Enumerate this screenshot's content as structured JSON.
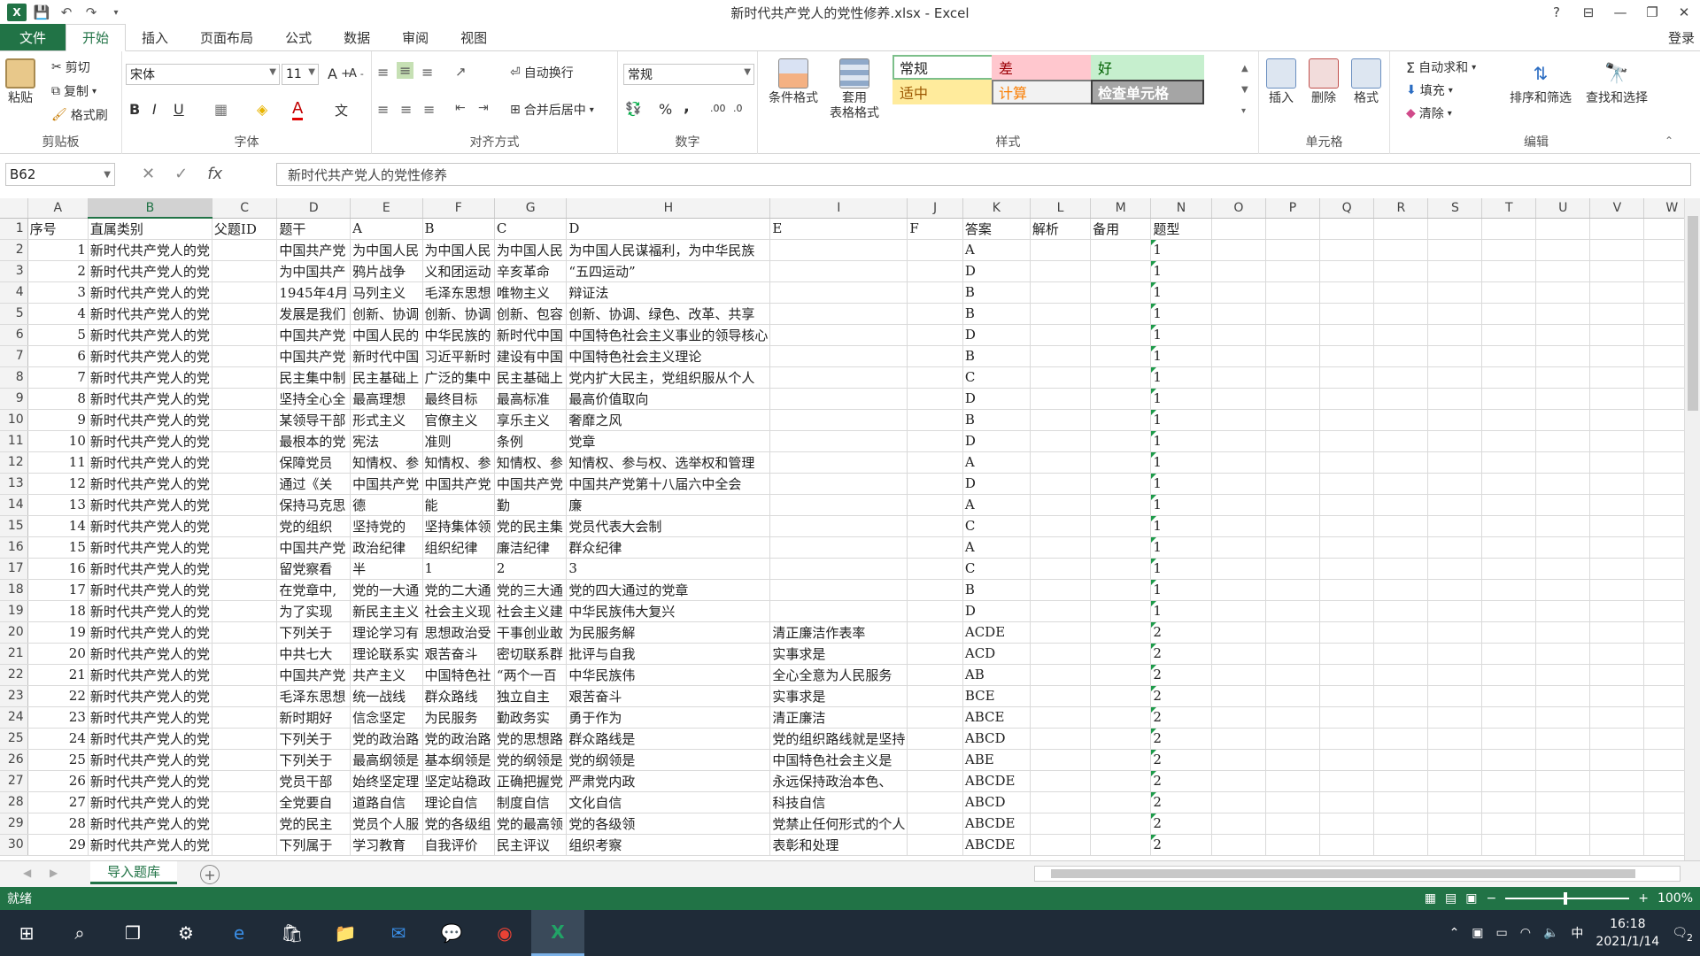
{
  "window": {
    "title": "新时代共产党人的党性修养.xlsx - Excel",
    "help": "?",
    "controls": [
      "⊟",
      "—",
      "❐",
      "✕"
    ]
  },
  "ribbon_tabs": [
    "文件",
    "开始",
    "插入",
    "页面布局",
    "公式",
    "数据",
    "审阅",
    "视图"
  ],
  "login_label": "登录",
  "clipboard": {
    "paste": "粘贴",
    "cut": "剪切",
    "copy": "复制",
    "format_painter": "格式刷",
    "label": "剪贴板"
  },
  "font": {
    "name": "宋体",
    "size": "11",
    "label": "字体",
    "bold": "B",
    "italic": "I",
    "underline": "U"
  },
  "alignment": {
    "wrap": "自动换行",
    "merge": "合并后居中",
    "label": "对齐方式"
  },
  "number": {
    "format": "常规",
    "label": "数字",
    "percent": "%",
    "comma": ","
  },
  "styles": {
    "conditional": "条件格式",
    "table": "套用\n表格格式",
    "label": "样式",
    "cells": [
      {
        "text": "常规",
        "bg": "#ffffff",
        "color": "#222222",
        "border": "#7cbf8a"
      },
      {
        "text": "差",
        "bg": "#ffc7ce",
        "color": "#9c0006",
        "border": "#ffc7ce"
      },
      {
        "text": "好",
        "bg": "#c6efce",
        "color": "#006100",
        "border": "#c6efce"
      },
      {
        "text": "适中",
        "bg": "#ffeb9c",
        "color": "#9c5700",
        "border": "#ffeb9c"
      },
      {
        "text": "计算",
        "bg": "#f2f2f2",
        "color": "#fa7d00",
        "border": "#7f7f7f"
      },
      {
        "text": "检查单元格",
        "bg": "#a5a5a5",
        "color": "#ffffff",
        "border": "#3f3f3f"
      }
    ]
  },
  "cells_group": {
    "insert": "插入",
    "delete": "删除",
    "format": "格式",
    "label": "单元格"
  },
  "editing": {
    "autosum": "自动求和",
    "fill": "填充",
    "clear": "清除",
    "sort": "排序和筛选",
    "find": "查找和选择",
    "label": "编辑"
  },
  "formula_bar": {
    "name_box": "B62",
    "fx": "fx",
    "value": "新时代共产党人的党性修养"
  },
  "columns": [
    "A",
    "B",
    "C",
    "D",
    "E",
    "F",
    "G",
    "H",
    "I",
    "J",
    "K",
    "L",
    "M",
    "N",
    "O",
    "P",
    "Q",
    "R",
    "S",
    "T",
    "U",
    "V",
    "W"
  ],
  "selected_column": "B",
  "header_row": [
    "序号",
    "直属类别",
    "父题ID",
    "题干",
    "A",
    "B",
    "C",
    "D",
    "E",
    "F",
    "答案",
    "解析",
    "备用",
    "题型"
  ],
  "rows": [
    [
      "1",
      "新时代共产党人的党",
      "",
      "中国共产党",
      "为中国人民",
      "为中国人民",
      "为中国人民",
      "为中国人民谋福利，为中华民族",
      "",
      "",
      "A",
      "",
      "",
      "1"
    ],
    [
      "2",
      "新时代共产党人的党",
      "",
      "为中国共产",
      "鸦片战争",
      "义和团运动",
      "辛亥革命",
      "“五四运动”",
      "",
      "",
      "D",
      "",
      "",
      "1"
    ],
    [
      "3",
      "新时代共产党人的党",
      "",
      "1945年4月",
      "马列主义",
      "毛泽东思想",
      "唯物主义",
      "辩证法",
      "",
      "",
      "B",
      "",
      "",
      "1"
    ],
    [
      "4",
      "新时代共产党人的党",
      "",
      "发展是我们",
      "创新、协调",
      "创新、协调",
      "创新、包容",
      "创新、协调、绿色、改革、共享",
      "",
      "",
      "B",
      "",
      "",
      "1"
    ],
    [
      "5",
      "新时代共产党人的党",
      "",
      "中国共产党",
      "中国人民的",
      "中华民族的",
      "新时代中国",
      "中国特色社会主义事业的领导核心",
      "",
      "",
      "D",
      "",
      "",
      "1"
    ],
    [
      "6",
      "新时代共产党人的党",
      "",
      "中国共产党",
      "新时代中国",
      "习近平新时",
      "建设有中国",
      "中国特色社会主义理论",
      "",
      "",
      "B",
      "",
      "",
      "1"
    ],
    [
      "7",
      "新时代共产党人的党",
      "",
      "民主集中制",
      "民主基础上",
      "广泛的集中",
      "民主基础上",
      "党内扩大民主，党组织服从个人",
      "",
      "",
      "C",
      "",
      "",
      "1"
    ],
    [
      "8",
      "新时代共产党人的党",
      "",
      "坚持全心全",
      "最高理想",
      "最终目标",
      "最高标准",
      "最高价值取向",
      "",
      "",
      "D",
      "",
      "",
      "1"
    ],
    [
      "9",
      "新时代共产党人的党",
      "",
      "某领导干部",
      "形式主义",
      "官僚主义",
      "享乐主义",
      "奢靡之风",
      "",
      "",
      "B",
      "",
      "",
      "1"
    ],
    [
      "10",
      "新时代共产党人的党",
      "",
      "最根本的党",
      "宪法",
      "准则",
      "条例",
      "党章",
      "",
      "",
      "D",
      "",
      "",
      "1"
    ],
    [
      "11",
      "新时代共产党人的党",
      "",
      "保障党员",
      "知情权、参",
      "知情权、参",
      "知情权、参",
      "知情权、参与权、选举权和管理",
      "",
      "",
      "A",
      "",
      "",
      "1"
    ],
    [
      "12",
      "新时代共产党人的党",
      "",
      "通过《关",
      "中国共产党",
      "中国共产党",
      "中国共产党",
      "中国共产党第十八届六中全会",
      "",
      "",
      "D",
      "",
      "",
      "1"
    ],
    [
      "13",
      "新时代共产党人的党",
      "",
      "保持马克思",
      "德",
      "能",
      "勤",
      "廉",
      "",
      "",
      "A",
      "",
      "",
      "1"
    ],
    [
      "14",
      "新时代共产党人的党",
      "",
      "党的组织",
      "坚持党的",
      "坚持集体领",
      "党的民主集",
      "党员代表大会制",
      "",
      "",
      "C",
      "",
      "",
      "1"
    ],
    [
      "15",
      "新时代共产党人的党",
      "",
      "中国共产党",
      "政治纪律",
      "组织纪律",
      "廉洁纪律",
      "群众纪律",
      "",
      "",
      "A",
      "",
      "",
      "1"
    ],
    [
      "16",
      "新时代共产党人的党",
      "",
      "留党察看",
      "半",
      "1",
      "2",
      "3",
      "",
      "",
      "C",
      "",
      "",
      "1"
    ],
    [
      "17",
      "新时代共产党人的党",
      "",
      "在党章中,",
      "党的一大通",
      "党的二大通",
      "党的三大通",
      "党的四大通过的党章",
      "",
      "",
      "B",
      "",
      "",
      "1"
    ],
    [
      "18",
      "新时代共产党人的党",
      "",
      "为了实现",
      "新民主主义",
      "社会主义现",
      "社会主义建",
      "中华民族伟大复兴",
      "",
      "",
      "D",
      "",
      "",
      "1"
    ],
    [
      "19",
      "新时代共产党人的党",
      "",
      "下列关于",
      "理论学习有",
      "思想政治受",
      "干事创业敢",
      "为民服务解",
      "清正廉洁作表率",
      "",
      "ACDE",
      "",
      "",
      "2"
    ],
    [
      "20",
      "新时代共产党人的党",
      "",
      "中共七大",
      "理论联系实",
      "艰苦奋斗",
      "密切联系群",
      "批评与自我",
      "实事求是",
      "",
      "ACD",
      "",
      "",
      "2"
    ],
    [
      "21",
      "新时代共产党人的党",
      "",
      "中国共产党",
      "共产主义",
      "中国特色社",
      "“两个一百",
      "中华民族伟",
      "全心全意为人民服务",
      "",
      "AB",
      "",
      "",
      "2"
    ],
    [
      "22",
      "新时代共产党人的党",
      "",
      "毛泽东思想",
      "统一战线",
      "群众路线",
      "独立自主",
      "艰苦奋斗",
      "实事求是",
      "",
      "BCE",
      "",
      "",
      "2"
    ],
    [
      "23",
      "新时代共产党人的党",
      "",
      "新时期好",
      "信念坚定",
      "为民服务",
      "勤政务实",
      "勇于作为",
      "清正廉洁",
      "",
      "ABCE",
      "",
      "",
      "2"
    ],
    [
      "24",
      "新时代共产党人的党",
      "",
      "下列关于",
      "党的政治路",
      "党的政治路",
      "党的思想路",
      "群众路线是",
      "党的组织路线就是坚持",
      "",
      "ABCD",
      "",
      "",
      "2"
    ],
    [
      "25",
      "新时代共产党人的党",
      "",
      "下列关于",
      "最高纲领是",
      "基本纲领是",
      "党的纲领是",
      "党的纲领是",
      "中国特色社会主义是",
      "",
      "ABE",
      "",
      "",
      "2"
    ],
    [
      "26",
      "新时代共产党人的党",
      "",
      "党员干部",
      "始终坚定理",
      "坚定站稳政",
      "正确把握党",
      "严肃党内政",
      "永远保持政治本色、",
      "",
      "ABCDE",
      "",
      "",
      "2"
    ],
    [
      "27",
      "新时代共产党人的党",
      "",
      "全党要自",
      "道路自信",
      "理论自信",
      "制度自信",
      "文化自信",
      "科技自信",
      "",
      "ABCD",
      "",
      "",
      "2"
    ],
    [
      "28",
      "新时代共产党人的党",
      "",
      "党的民主",
      "党员个人服",
      "党的各级组",
      "党的最高领",
      "党的各级领",
      "党禁止任何形式的个人",
      "",
      "ABCDE",
      "",
      "",
      "2"
    ],
    [
      "29",
      "新时代共产党人的党",
      "",
      "下列属于",
      "学习教育",
      "自我评价",
      "民主评议",
      "组织考察",
      "表彰和处理",
      "",
      "ABCDE",
      "",
      "",
      "2"
    ]
  ],
  "sheet_tab": "导入题库",
  "status": {
    "ready": "就绪",
    "zoom": "100%"
  },
  "taskbar": {
    "time": "16:18",
    "date": "2021/1/14",
    "ime": "中",
    "notifications": "2"
  }
}
